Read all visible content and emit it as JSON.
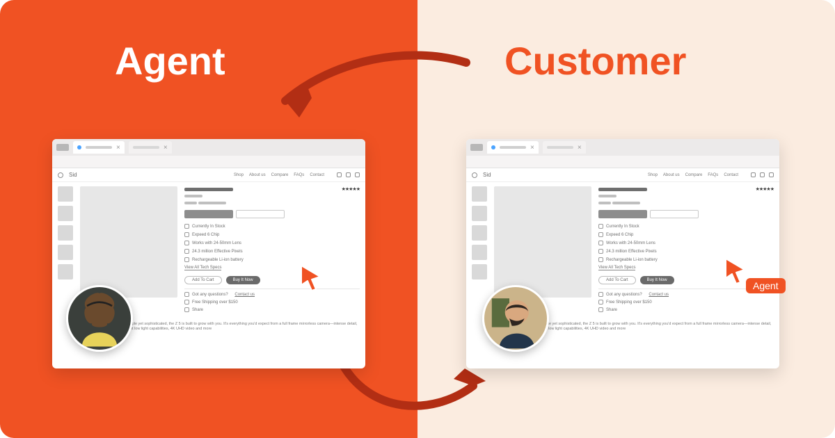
{
  "titles": {
    "agent": "Agent",
    "customer": "Customer"
  },
  "cursor_tag": "Agent",
  "site": {
    "name": "Sid",
    "nav": [
      "Shop",
      "About us",
      "Compare",
      "FAQs",
      "Contact"
    ]
  },
  "product": {
    "features": {
      "stock": "Currently In Stock",
      "chip": "Expeed 6 Chip",
      "lens": "Works with 24-50mm Lens",
      "pixels": "24.3 million Effective Pixels",
      "battery": "Rechargeable Li-ion battery",
      "specs": "View All Tech Specs"
    },
    "buttons": {
      "add": "Add To Cart",
      "buy": "Buy It Now"
    },
    "meta": {
      "questions_label": "Got any questions?",
      "questions_link": "Contact us",
      "shipping": "Free Shipping over $150",
      "share": "Share"
    },
    "blurb": "begins with the Z 5. Simple yet sophisticated, the Z 5 is built to grow with you. It's everything you'd expect from a full frame mirrorless camera—intense detail, expansive views, brilliant low light capabilities, 4K UHD video and more"
  }
}
